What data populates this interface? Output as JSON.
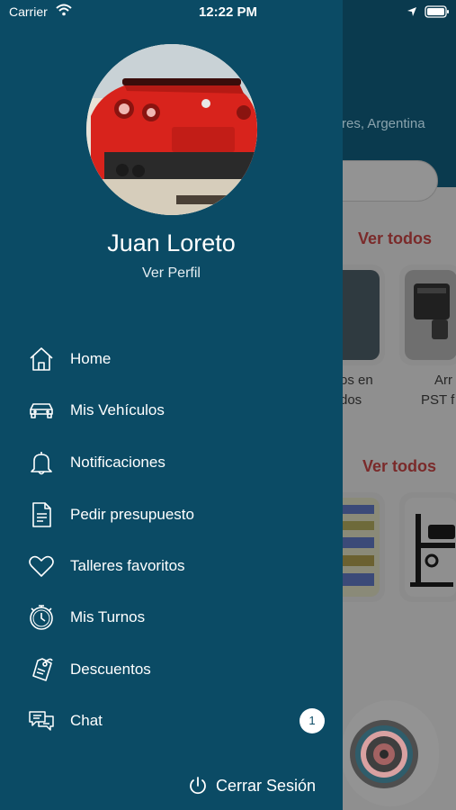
{
  "status_bar": {
    "carrier": "Carrier",
    "time": "12:22 PM"
  },
  "background": {
    "location": "res, Argentina",
    "section1_link": "Ver todos",
    "section2_link": "Ver todos",
    "card1_caption_line1": "os en",
    "card1_caption_line2": "dos",
    "card2_caption_line1": "Arr",
    "card2_caption_line2": "PST f"
  },
  "profile": {
    "name": "Juan Loreto",
    "link": "Ver Perfil"
  },
  "menu": {
    "items": [
      {
        "label": "Home",
        "icon": "home-icon"
      },
      {
        "label": "Mis Vehículos",
        "icon": "car-icon"
      },
      {
        "label": "Notificaciones",
        "icon": "bell-icon"
      },
      {
        "label": "Pedir presupuesto",
        "icon": "document-icon"
      },
      {
        "label": "Talleres favoritos",
        "icon": "heart-icon"
      },
      {
        "label": "Mis Turnos",
        "icon": "stopwatch-icon"
      },
      {
        "label": "Descuentos",
        "icon": "tag-icon"
      },
      {
        "label": "Chat",
        "icon": "chat-icon"
      }
    ],
    "chat_badge": "1"
  },
  "logout": {
    "label": "Cerrar Sesión",
    "icon": "power-icon"
  },
  "colors": {
    "drawer_bg": "#0b4b65",
    "overlay": "#8f8f8f",
    "accent_link": "#7a2a2a",
    "text": "#ffffff"
  }
}
